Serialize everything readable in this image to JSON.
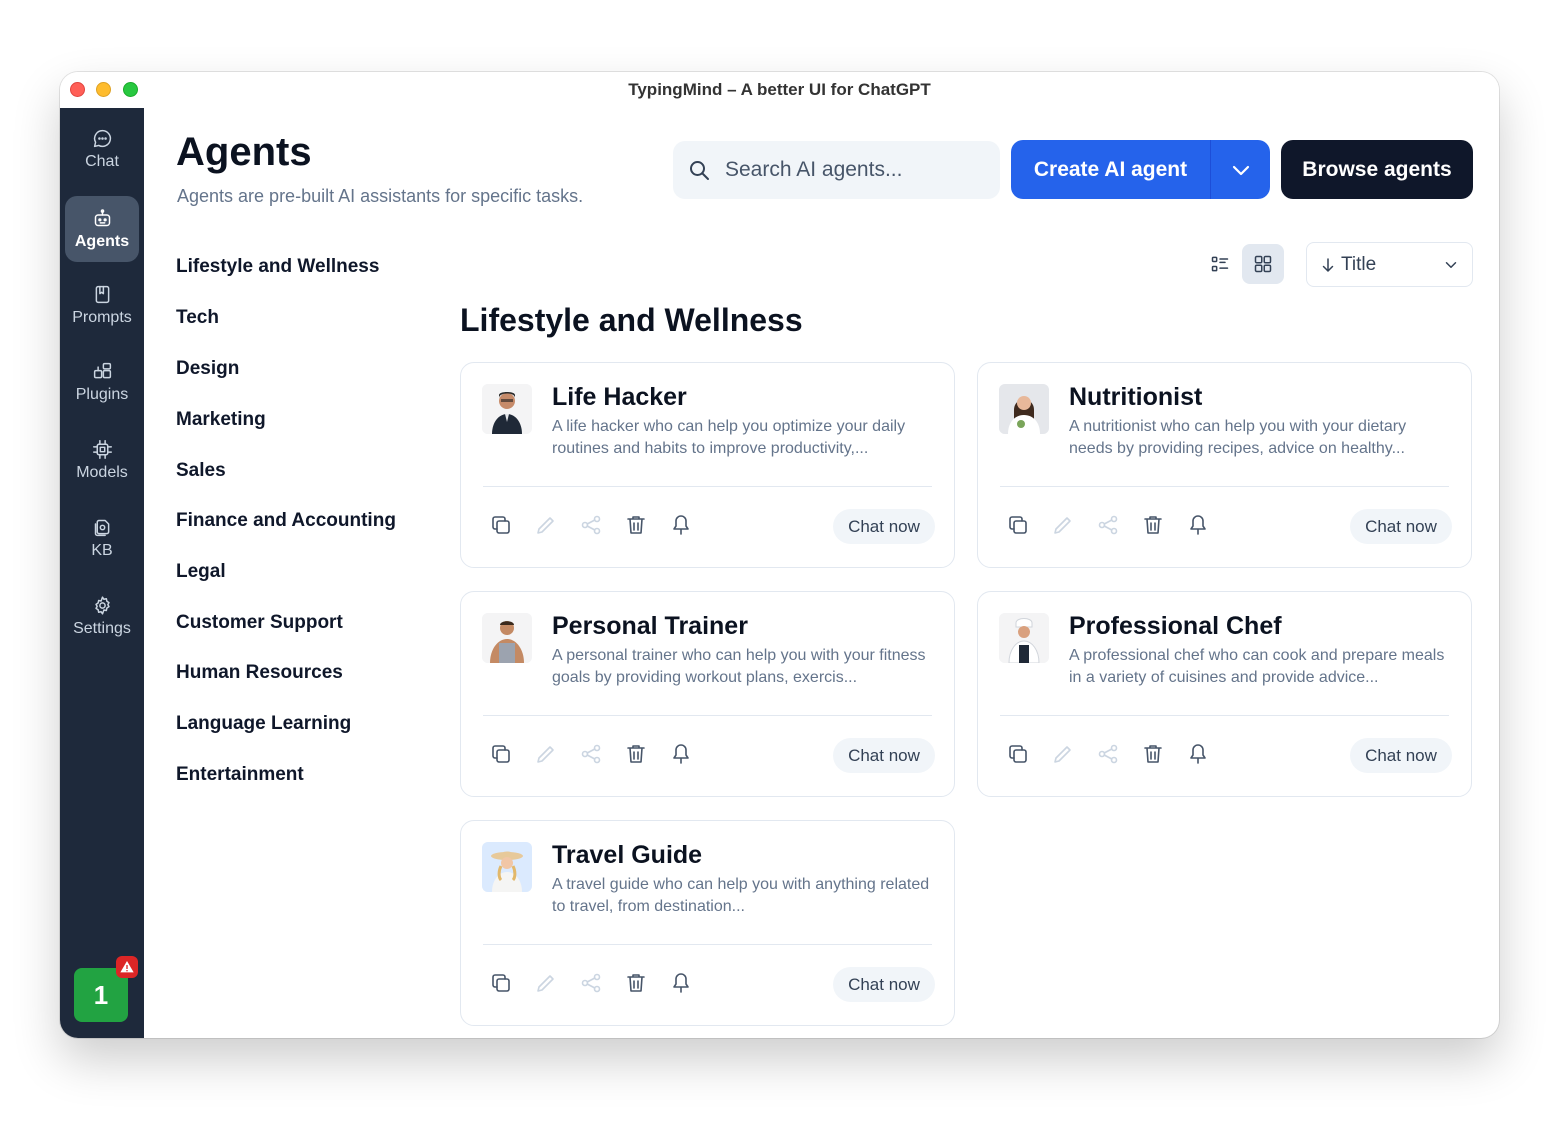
{
  "window": {
    "title": "TypingMind – A better UI for ChatGPT"
  },
  "sidebar": {
    "items": [
      {
        "label": "Chat",
        "icon": "chat-bubble-icon"
      },
      {
        "label": "Agents",
        "icon": "robot-icon",
        "active": true
      },
      {
        "label": "Prompts",
        "icon": "book-icon"
      },
      {
        "label": "Plugins",
        "icon": "puzzle-icon"
      },
      {
        "label": "Models",
        "icon": "chip-icon"
      },
      {
        "label": "KB",
        "icon": "files-icon"
      },
      {
        "label": "Settings",
        "icon": "gear-icon"
      }
    ],
    "badge": "1"
  },
  "header": {
    "title": "Agents",
    "subtitle": "Agents are pre-built AI assistants for specific tasks.",
    "search_placeholder": "Search AI agents...",
    "create_label": "Create AI agent",
    "browse_label": "Browse agents"
  },
  "categories": [
    "Lifestyle and Wellness",
    "Tech",
    "Design",
    "Marketing",
    "Sales",
    "Finance and Accounting",
    "Legal",
    "Customer Support",
    "Human Resources",
    "Language Learning",
    "Entertainment"
  ],
  "view": {
    "sort_label": "Title",
    "mode": "grid"
  },
  "section": {
    "title": "Lifestyle and Wellness"
  },
  "agents": [
    {
      "name": "Life Hacker",
      "desc": "A life hacker who can help you optimize your daily routines and habits to improve productivity,...",
      "action": "Chat now"
    },
    {
      "name": "Nutritionist",
      "desc": "A nutritionist who can help you with your dietary needs by providing recipes, advice on healthy...",
      "action": "Chat now"
    },
    {
      "name": "Personal Trainer",
      "desc": "A personal trainer who can help you with your fitness goals by providing workout plans, exercis...",
      "action": "Chat now"
    },
    {
      "name": "Professional Chef",
      "desc": "A professional chef who can cook and prepare meals in a variety of cuisines and provide advice...",
      "action": "Chat now"
    },
    {
      "name": "Travel Guide",
      "desc": "A travel guide who can help you with anything related to travel, from destination...",
      "action": "Chat now"
    }
  ],
  "colors": {
    "primary": "#2563eb",
    "dark": "#0f172a",
    "sidebar": "#1e293b",
    "badge": "#22a342"
  }
}
